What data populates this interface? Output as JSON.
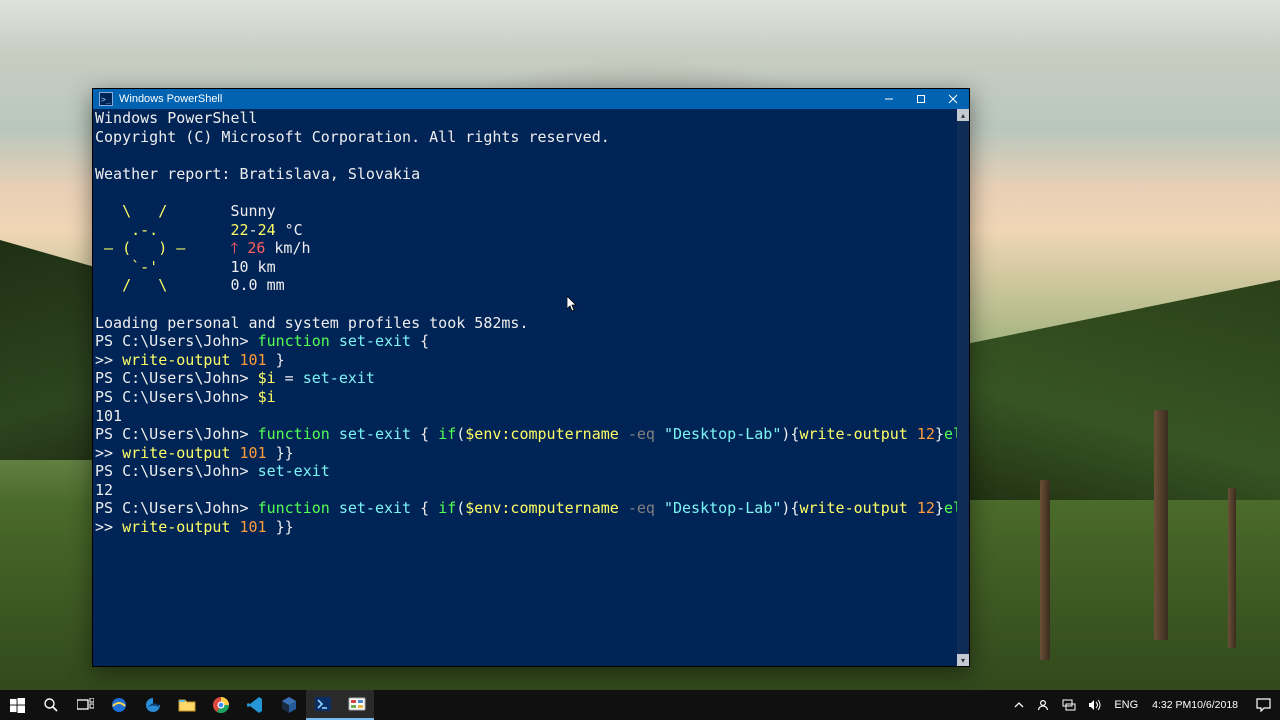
{
  "window": {
    "title": "Windows PowerShell"
  },
  "console": {
    "header1": "Windows PowerShell",
    "header2": "Copyright (C) Microsoft Corporation. All rights reserved.",
    "weather": {
      "title": "Weather report: Bratislava, Slovakia",
      "art1": "   \\   /    ",
      "art2": "    .-.     ",
      "art3": " ― (   ) ―  ",
      "art4": "    `-'     ",
      "art5": "   /   \\    ",
      "cond": "Sunny",
      "temp_prefix": "22",
      "temp_dash": "-",
      "temp_suffix": "24",
      "temp_unit": " °C",
      "wind_icon": "🡑 ",
      "wind_val": "26",
      "wind_unit": " km/h",
      "vis": "10 km",
      "precip": "0.0 mm"
    },
    "profiles": "Loading personal and system profiles took 582ms.",
    "prompt": "PS C:\\Users\\John> ",
    "cont": ">> ",
    "kw_function": "function",
    "kw_if": "if",
    "kw_else": "else",
    "tok": {
      "setexit": "set-exit",
      "writeoutput": "write-output",
      "openbrace": " {",
      "space": " ",
      "n101": "101",
      "n12": "12",
      "closebrace": " }",
      "closebrace2": " }}",
      "vari": "$i",
      "eq": " = ",
      "openparen": "(",
      "envvar": "$env:computername",
      "dash_eq": " -eq ",
      "str": "\"Desktop-Lab\"",
      "closeparen": ")",
      "opencurl": "{",
      "closecurl": "}",
      "opencurlsp": " { "
    },
    "out_101": "101",
    "out_12": "12"
  },
  "taskbar": {
    "lang": "ENG",
    "time": "4:32 PM",
    "date": "10/6/2018"
  },
  "icons": {
    "start": "start-icon",
    "search": "search-icon",
    "taskview": "task-view-icon",
    "ie": "internet-explorer-icon",
    "edge": "edge-icon",
    "explorer": "file-explorer-icon",
    "chrome": "chrome-icon",
    "vscode": "vscode-icon",
    "bluecube": "webpack-icon",
    "powershell": "powershell-icon",
    "paintish": "screen-recorder-icon",
    "tray_up": "show-hidden-icon",
    "people": "people-icon",
    "net": "network-icon",
    "vol": "volume-icon",
    "action": "action-center-icon"
  }
}
